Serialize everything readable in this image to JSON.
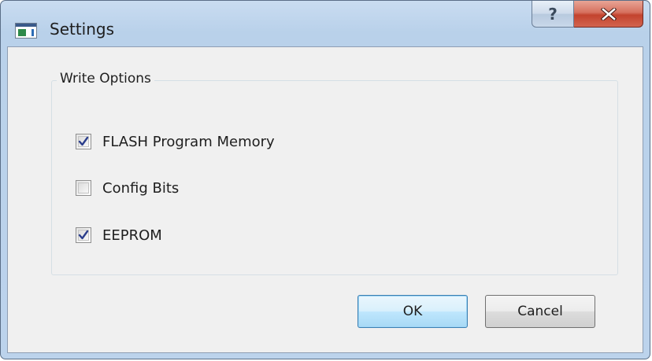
{
  "window": {
    "title": "Settings",
    "help_glyph": "?",
    "close_glyph": "X"
  },
  "groupbox": {
    "title": "Write Options"
  },
  "options": [
    {
      "label": "FLASH Program Memory",
      "checked": true
    },
    {
      "label": "Config Bits",
      "checked": false
    },
    {
      "label": "EEPROM",
      "checked": true
    }
  ],
  "buttons": {
    "ok_label": "OK",
    "cancel_label": "Cancel"
  },
  "colors": {
    "check_mark": "#2b3e8c",
    "close_button": "#c3432e",
    "default_button_border": "#3c7fb1"
  },
  "icons": {
    "app": "settings-app-icon",
    "help": "help-icon",
    "close": "close-icon",
    "check": "checkmark-icon"
  }
}
